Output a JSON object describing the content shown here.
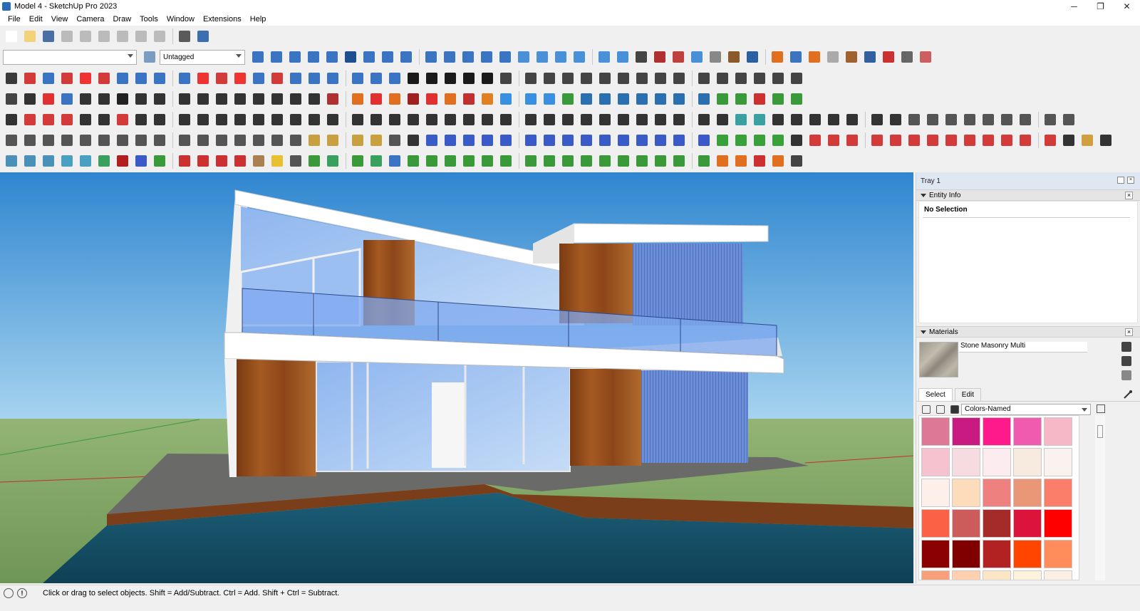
{
  "window": {
    "title": "Model 4 - SketchUp Pro 2023",
    "controls": [
      "─",
      "❐",
      "✕"
    ]
  },
  "menu": [
    "File",
    "Edit",
    "View",
    "Camera",
    "Draw",
    "Tools",
    "Window",
    "Extensions",
    "Help"
  ],
  "tag_combo": {
    "value": "Untagged"
  },
  "tray": {
    "title": "Tray 1"
  },
  "entity_info": {
    "title": "Entity Info",
    "selection": "No Selection"
  },
  "materials": {
    "title": "Materials",
    "current_material": "Stone Masonry Multi",
    "tabs": [
      "Select",
      "Edit"
    ],
    "library": "Colors-Named",
    "swatches": [
      "#dd7896",
      "#c91a82",
      "#ff1a8c",
      "#f05bb0",
      "#f6b8c6",
      "#f7c2cf",
      "#f6dbe0",
      "#fcecf0",
      "#f7ebe0",
      "#faf2ef",
      "#fdf0ea",
      "#fcdcba",
      "#ef8080",
      "#e99777",
      "#fa7e6a",
      "#fb6145",
      "#cc5c5c",
      "#a52a2a",
      "#dc143c",
      "#ff0000",
      "#8b0000",
      "#800000",
      "#b22222",
      "#ff4500",
      "#ff8c5a",
      "#f8a07c",
      "#ffd0b0",
      "#fde5c8",
      "#fff2dc",
      "#fcf0e4"
    ]
  },
  "status": {
    "message": "Click or drag to select objects. Shift = Add/Subtract. Ctrl = Add. Shift + Ctrl = Subtract."
  },
  "toolbars": [
    [
      "#ffffff",
      "#f4d27a",
      "#4a6fa5",
      "#bbbbbb",
      "#bbbbbb",
      "#bbbbbb",
      "#bbbbbb",
      "#bbbbbb",
      "#bbbbbb",
      "#5a5a5a",
      "#3b6fb0"
    ],
    [
      "#3a74c2",
      "#3a74c2",
      "#3a74c2",
      "#3a74c2",
      "#3a74c2",
      "#1e4f8f",
      "#3a74c2",
      "#3a74c2",
      "#3a74c2",
      "#3a74c2",
      "#3a74c2",
      "#3a74c2",
      "#3a74c2",
      "#3a74c2",
      "#4a90d9",
      "#4a90d9",
      "#4a90d9",
      "#4a90d9",
      "#4a90d9",
      "#4a90d9",
      "#444444",
      "#b03030",
      "#c04040",
      "#4a90d9",
      "#888888",
      "#8a5a2a",
      "#2a5fa0",
      "#e07020",
      "#3a74c2",
      "#e07020",
      "#aaaaaa",
      "#a06030",
      "#3060a0",
      "#cc3030",
      "#666666",
      "#cc6060"
    ],
    [
      "#3a3a3a",
      "#d33b3b",
      "#3a74c2",
      "#d33b3b",
      "#e33",
      "#d33b3b",
      "#3a74c2",
      "#3a74c2",
      "#3a74c2",
      "#3a74c2",
      "#e33",
      "#d33b3b",
      "#e33",
      "#3a74c2",
      "#d33b3b",
      "#3a74c2",
      "#3a74c2",
      "#3a74c2",
      "#3a74c2",
      "#3a74c2",
      "#3a74c2",
      "#1a1a1a",
      "#1a1a1a",
      "#1a1a1a",
      "#1a1a1a",
      "#1a1a1a",
      "#444444",
      "#444444",
      "#444444",
      "#444444",
      "#444444",
      "#444444",
      "#444444",
      "#444444",
      "#444444",
      "#444444",
      "#444444",
      "#444444",
      "#444444",
      "#444444",
      "#444444",
      "#444444"
    ],
    [
      "#444444",
      "#333333",
      "#e03030",
      "#3a74c2",
      "#333333",
      "#333333",
      "#222222",
      "#333333",
      "#333333",
      "#333333",
      "#333333",
      "#333333",
      "#333333",
      "#333333",
      "#333333",
      "#333333",
      "#333333",
      "#b03030",
      "#e07020",
      "#e03030",
      "#e07020",
      "#a02020",
      "#e03030",
      "#e07020",
      "#c03030",
      "#e08020",
      "#3a90e0",
      "#3a90e0",
      "#3a90e0",
      "#3a9a3a",
      "#2a6fb0",
      "#2a6fb0",
      "#2a6fb0",
      "#2a6fb0",
      "#2a6fb0",
      "#2a6fb0",
      "#2a6fb0",
      "#3a9a3a",
      "#3a9a3a",
      "#cc3030",
      "#3a9a3a",
      "#3a9a3a"
    ],
    [
      "#333333",
      "#d33b3b",
      "#d33b3b",
      "#d33b3b",
      "#333333",
      "#333333",
      "#d33b3b",
      "#333333",
      "#333333",
      "#333333",
      "#333333",
      "#333333",
      "#333333",
      "#333333",
      "#333333",
      "#333333",
      "#333333",
      "#333333",
      "#333333",
      "#333333",
      "#333333",
      "#333333",
      "#333333",
      "#333333",
      "#333333",
      "#333333",
      "#333333",
      "#333333",
      "#333333",
      "#333333",
      "#333333",
      "#333333",
      "#333333",
      "#333333",
      "#333333",
      "#333333",
      "#333333",
      "#333333",
      "#3aa0a0",
      "#3aa0a0",
      "#333333",
      "#333333",
      "#333333",
      "#333333",
      "#333333",
      "#333333",
      "#333333",
      "#555555",
      "#555555",
      "#555555",
      "#555555",
      "#555555",
      "#555555",
      "#555555",
      "#555555",
      "#555555"
    ],
    [
      "#555555",
      "#555555",
      "#555555",
      "#555555",
      "#555555",
      "#555555",
      "#555555",
      "#555555",
      "#555555",
      "#555555",
      "#555555",
      "#555555",
      "#555555",
      "#555555",
      "#555555",
      "#555555",
      "#c8a040",
      "#c8a040",
      "#c8a040",
      "#c8a040",
      "#555555",
      "#333333",
      "#3a5ac8",
      "#3a5ac8",
      "#3a5ac8",
      "#3a5ac8",
      "#3a5ac8",
      "#3a5ac8",
      "#3a5ac8",
      "#3a5ac8",
      "#3a5ac8",
      "#3a5ac8",
      "#3a5ac8",
      "#3a5ac8",
      "#3a5ac8",
      "#3a5ac8",
      "#3a5ac8",
      "#3aa03a",
      "#3aa03a",
      "#3aa03a",
      "#3aa03a",
      "#333333",
      "#d33b3b",
      "#d33b3b",
      "#d33b3b",
      "#d33b3b",
      "#d33b3b",
      "#d33b3b",
      "#d33b3b",
      "#d33b3b",
      "#d33b3b",
      "#d33b3b",
      "#d33b3b",
      "#d33b3b",
      "#d33b3b",
      "#333333",
      "#d0a040",
      "#333333"
    ],
    [
      "#4a90b8",
      "#4a90b8",
      "#4a90b8",
      "#4aa0c0",
      "#4aa0c0",
      "#3aa060",
      "#b02020",
      "#3a5ac8",
      "#3a9a3a",
      "#cc3030",
      "#cc3030",
      "#cc3030",
      "#cc3030",
      "#aa8050",
      "#e8c030",
      "#555555",
      "#3a9a3a",
      "#3aa060",
      "#3a9a3a",
      "#3aa060",
      "#3a74c2",
      "#3a9a3a",
      "#3a9a3a",
      "#3a9a3a",
      "#3a9a3a",
      "#3a9a3a",
      "#3a9a3a",
      "#3a9a3a",
      "#3a9a3a",
      "#3a9a3a",
      "#3a9a3a",
      "#3a9a3a",
      "#3a9a3a",
      "#3a9a3a",
      "#3a9a3a",
      "#3a9a3a",
      "#3a9a3a",
      "#e07020",
      "#e07020",
      "#cc3030",
      "#e07020",
      "#444444"
    ]
  ]
}
